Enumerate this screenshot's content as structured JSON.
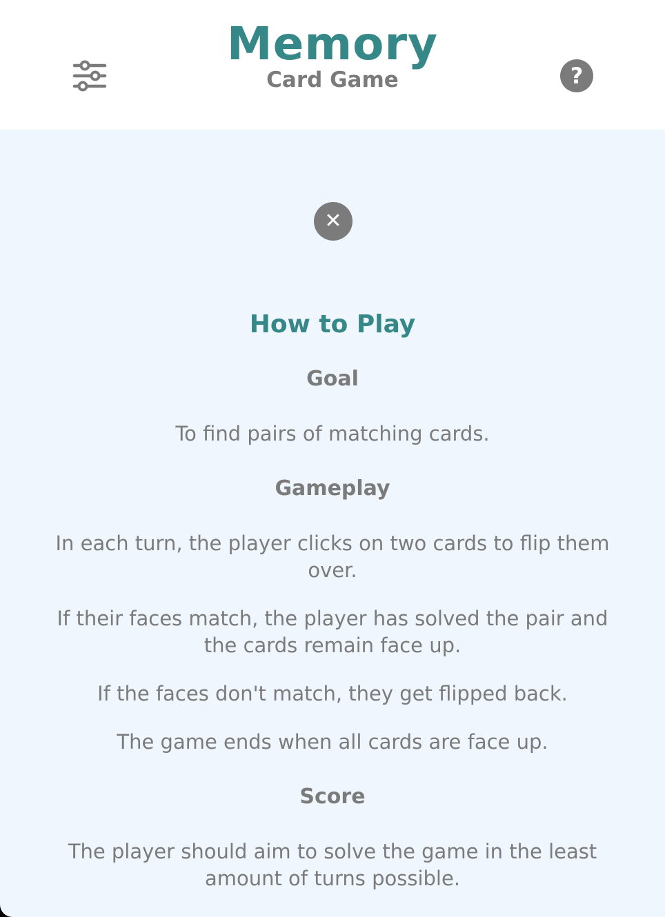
{
  "header": {
    "title": "Memory",
    "subtitle": "Card Game",
    "settings_icon": "sliders-icon",
    "help_icon": "question-mark-icon",
    "help_glyph": "?"
  },
  "modal": {
    "close_icon": "close-icon",
    "close_glyph": "✕",
    "title": "How to Play",
    "sections": [
      {
        "heading": "Goal",
        "paragraphs": [
          "To find pairs of matching cards."
        ]
      },
      {
        "heading": "Gameplay",
        "paragraphs": [
          "In each turn, the player clicks on two cards to flip them over.",
          "If their faces match, the player has solved the pair and the cards remain face up.",
          "If the faces don't match, they get flipped back.",
          "The game ends when all cards are face up."
        ]
      },
      {
        "heading": "Score",
        "paragraphs": [
          "The player should aim to solve the game in the least amount of turns possible."
        ]
      }
    ]
  },
  "colors": {
    "accent": "#368888",
    "text": "#7b7b7b",
    "modal_background": "#eff6fd",
    "header_background": "#ffffff"
  }
}
